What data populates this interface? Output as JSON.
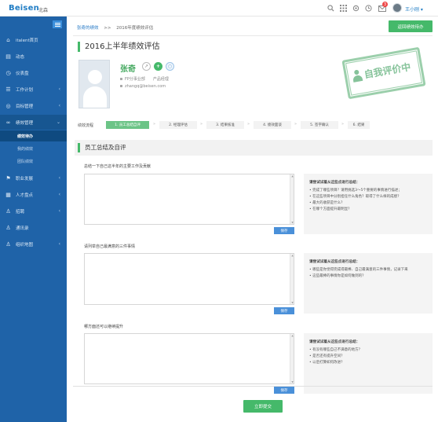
{
  "header": {
    "logo": "Beisen",
    "city": "北森",
    "user_name": "王小刚 ▾",
    "mail_badge": "3"
  },
  "sidebar": {
    "items": [
      {
        "label": "italent首页",
        "icon": "home-icon",
        "glyph": "⌂"
      },
      {
        "label": "动态",
        "icon": "feed-icon",
        "glyph": "▤"
      },
      {
        "label": "仪表盘",
        "icon": "dashboard-icon",
        "glyph": "◷"
      },
      {
        "label": "工作计划",
        "icon": "plan-icon",
        "glyph": "☰"
      },
      {
        "label": "目标管理",
        "icon": "target-icon",
        "glyph": "◎"
      },
      {
        "label": "绩效管理",
        "icon": "performance-icon",
        "glyph": "∞"
      },
      {
        "label": "职业发展",
        "icon": "career-icon",
        "glyph": "⚑"
      },
      {
        "label": "人才盘点",
        "icon": "talent-icon",
        "glyph": "▦"
      },
      {
        "label": "招聘",
        "icon": "recruit-icon",
        "glyph": "♙"
      },
      {
        "label": "通讯录",
        "icon": "contacts-icon",
        "glyph": "♙"
      },
      {
        "label": "组织地图",
        "icon": "org-map-icon",
        "glyph": "♙"
      }
    ],
    "sub_items": [
      "绩效待办",
      "我的绩效",
      "团队绩效"
    ]
  },
  "breadcrumb": {
    "link": "张奇的绩效",
    "sep": ">>",
    "current": "2016年度绩效评估"
  },
  "return_button": "返回绩效待办",
  "page_title": "2016上半年绩效评估",
  "employee": {
    "name": "张奇",
    "dept": "FP分事业部",
    "title": "产品经理",
    "email": "zhangq@beisen.com"
  },
  "stamp": "自我评价中",
  "flow": {
    "label": "绩效流程",
    "steps": [
      "1. 员工总结自评",
      "2. 经理评估",
      "3. 结果核准",
      "4. 绩效面谈",
      "5. 签字确认",
      "6. 结果"
    ],
    "arrow": "»"
  },
  "section_title": "员工总结及自评",
  "questions": [
    {
      "label": "总结一下自己这半年的主要工作及贡献",
      "save": "保存",
      "tips_title": "请尝试试着从这些点进行总结：",
      "tips": [
        "• 完成了哪些项目？请用挑选3～5个重要的事情进行描述；",
        "• 在这些项目中分别担任什么角色？取得了什么样的成绩？",
        "• 最大的收获是什么？",
        "• 在哪个方面提升最明显？"
      ]
    },
    {
      "label": "请列举自己最满意的三件事情",
      "save": "保存",
      "tips_title": "请尝试试着从这些点进行总结：",
      "tips": [
        "• 哪些是你觉得完成得最棒、自己最满意的三件事情，记录下来",
        "• 这些最棒的事情你是如何做到的？"
      ]
    },
    {
      "label": "哪方面还可以继续提升",
      "save": "保存",
      "tips_title": "请尝试试着从这些点进行总结：",
      "tips": [
        "• 有没有哪些自己不满意的地方？",
        "• 是否还有提升空间？",
        "• 以后打算如何改进？"
      ]
    }
  ],
  "submit_button": "立即提交",
  "colors": {
    "sidebar": "#1f63a8",
    "accent_green": "#45b96a",
    "link_blue": "#2a7cc7"
  }
}
